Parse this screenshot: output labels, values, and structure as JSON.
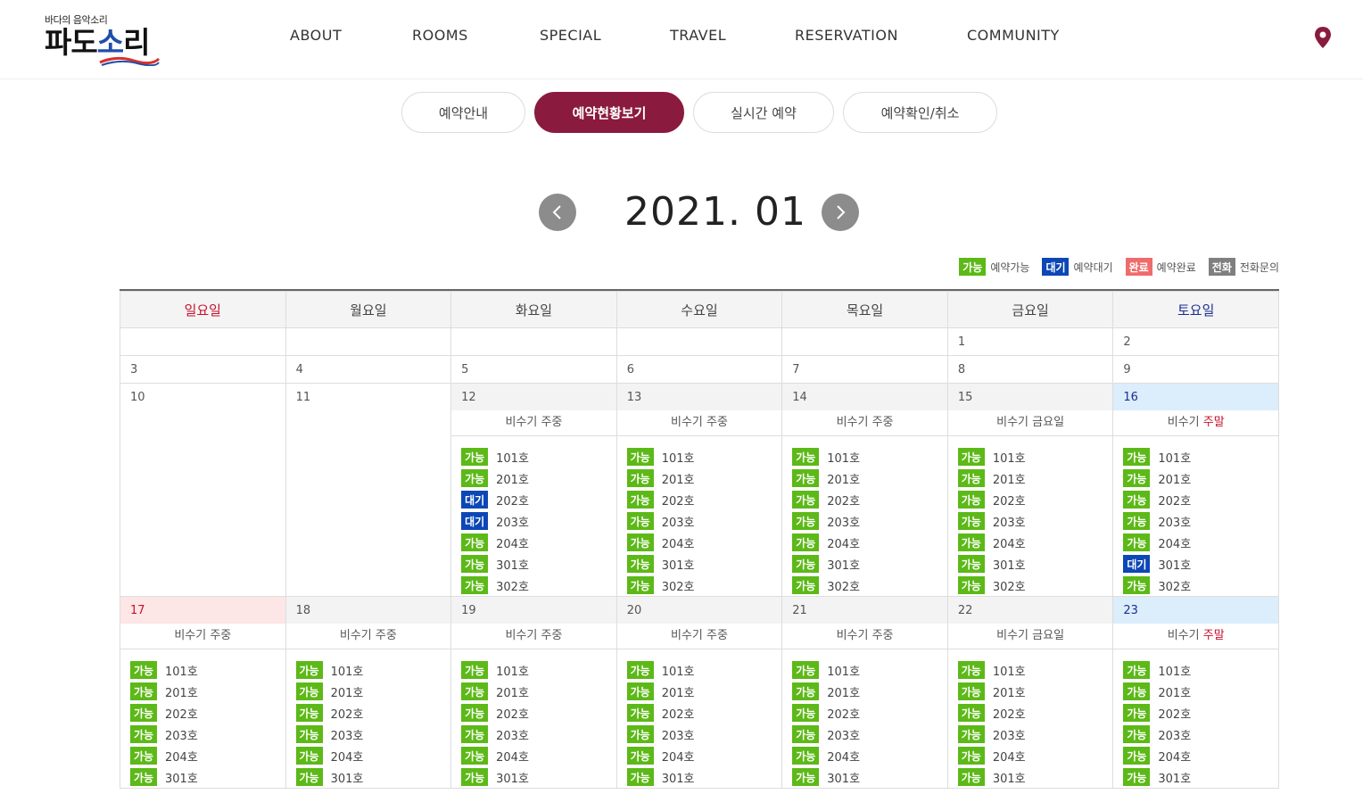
{
  "header": {
    "logo_tagline": "바다의 음악소리",
    "logo_text_1": "파도",
    "logo_text_2": "소",
    "logo_text_3": "리",
    "nav": [
      "ABOUT",
      "ROOMS",
      "SPECIAL",
      "TRAVEL",
      "RESERVATION",
      "COMMUNITY"
    ]
  },
  "tabs": [
    "예약안내",
    "예약현황보기",
    "실시간 예약",
    "예약확인/취소"
  ],
  "active_tab": 1,
  "month_title": "2021. 01",
  "legend": [
    {
      "badge": "가능",
      "label": "예약가능",
      "color": "#5cb917"
    },
    {
      "badge": "대기",
      "label": "예약대기",
      "color": "#0d47b6"
    },
    {
      "badge": "완료",
      "label": "예약완료",
      "color": "#f06b6b"
    },
    {
      "badge": "전화",
      "label": "전화문의",
      "color": "#7f7f7f"
    }
  ],
  "weekdays": [
    "일요일",
    "월요일",
    "화요일",
    "수요일",
    "목요일",
    "금요일",
    "토요일"
  ],
  "status_labels": {
    "g": "가능",
    "w": "대기",
    "d": "완료",
    "p": "전화"
  },
  "weeks": [
    {
      "days": [
        {
          "num": ""
        },
        {
          "num": ""
        },
        {
          "num": ""
        },
        {
          "num": ""
        },
        {
          "num": ""
        },
        {
          "num": "1"
        },
        {
          "num": "2"
        }
      ]
    },
    {
      "days": [
        {
          "num": "3"
        },
        {
          "num": "4"
        },
        {
          "num": "5"
        },
        {
          "num": "6"
        },
        {
          "num": "7"
        },
        {
          "num": "8"
        },
        {
          "num": "9"
        }
      ]
    },
    {
      "days": [
        {
          "num": "10"
        },
        {
          "num": "11"
        },
        {
          "num": "12",
          "season": "비수기 주중",
          "rooms": [
            [
              "g",
              "101호"
            ],
            [
              "g",
              "201호"
            ],
            [
              "w",
              "202호"
            ],
            [
              "w",
              "203호"
            ],
            [
              "g",
              "204호"
            ],
            [
              "g",
              "301호"
            ],
            [
              "g",
              "302호"
            ]
          ]
        },
        {
          "num": "13",
          "season": "비수기 주중",
          "rooms": [
            [
              "g",
              "101호"
            ],
            [
              "g",
              "201호"
            ],
            [
              "g",
              "202호"
            ],
            [
              "g",
              "203호"
            ],
            [
              "g",
              "204호"
            ],
            [
              "g",
              "301호"
            ],
            [
              "g",
              "302호"
            ]
          ]
        },
        {
          "num": "14",
          "season": "비수기 주중",
          "rooms": [
            [
              "g",
              "101호"
            ],
            [
              "g",
              "201호"
            ],
            [
              "g",
              "202호"
            ],
            [
              "g",
              "203호"
            ],
            [
              "g",
              "204호"
            ],
            [
              "g",
              "301호"
            ],
            [
              "g",
              "302호"
            ]
          ]
        },
        {
          "num": "15",
          "season": "비수기 금요일",
          "rooms": [
            [
              "g",
              "101호"
            ],
            [
              "g",
              "201호"
            ],
            [
              "g",
              "202호"
            ],
            [
              "g",
              "203호"
            ],
            [
              "g",
              "204호"
            ],
            [
              "g",
              "301호"
            ],
            [
              "g",
              "302호"
            ]
          ]
        },
        {
          "num": "16",
          "season": "비수기 ",
          "season_wk": "주말",
          "rooms": [
            [
              "g",
              "101호"
            ],
            [
              "g",
              "201호"
            ],
            [
              "g",
              "202호"
            ],
            [
              "g",
              "203호"
            ],
            [
              "g",
              "204호"
            ],
            [
              "w",
              "301호"
            ],
            [
              "g",
              "302호"
            ]
          ]
        }
      ]
    },
    {
      "days": [
        {
          "num": "17",
          "season": "비수기 주중",
          "rooms": [
            [
              "g",
              "101호"
            ],
            [
              "g",
              "201호"
            ],
            [
              "g",
              "202호"
            ],
            [
              "g",
              "203호"
            ],
            [
              "g",
              "204호"
            ],
            [
              "g",
              "301호"
            ]
          ]
        },
        {
          "num": "18",
          "season": "비수기 주중",
          "rooms": [
            [
              "g",
              "101호"
            ],
            [
              "g",
              "201호"
            ],
            [
              "g",
              "202호"
            ],
            [
              "g",
              "203호"
            ],
            [
              "g",
              "204호"
            ],
            [
              "g",
              "301호"
            ]
          ]
        },
        {
          "num": "19",
          "season": "비수기 주중",
          "rooms": [
            [
              "g",
              "101호"
            ],
            [
              "g",
              "201호"
            ],
            [
              "g",
              "202호"
            ],
            [
              "g",
              "203호"
            ],
            [
              "g",
              "204호"
            ],
            [
              "g",
              "301호"
            ]
          ]
        },
        {
          "num": "20",
          "season": "비수기 주중",
          "rooms": [
            [
              "g",
              "101호"
            ],
            [
              "g",
              "201호"
            ],
            [
              "g",
              "202호"
            ],
            [
              "g",
              "203호"
            ],
            [
              "g",
              "204호"
            ],
            [
              "g",
              "301호"
            ]
          ]
        },
        {
          "num": "21",
          "season": "비수기 주중",
          "rooms": [
            [
              "g",
              "101호"
            ],
            [
              "g",
              "201호"
            ],
            [
              "g",
              "202호"
            ],
            [
              "g",
              "203호"
            ],
            [
              "g",
              "204호"
            ],
            [
              "g",
              "301호"
            ]
          ]
        },
        {
          "num": "22",
          "season": "비수기 금요일",
          "rooms": [
            [
              "g",
              "101호"
            ],
            [
              "g",
              "201호"
            ],
            [
              "g",
              "202호"
            ],
            [
              "g",
              "203호"
            ],
            [
              "g",
              "204호"
            ],
            [
              "g",
              "301호"
            ]
          ]
        },
        {
          "num": "23",
          "season": "비수기 ",
          "season_wk": "주말",
          "rooms": [
            [
              "g",
              "101호"
            ],
            [
              "g",
              "201호"
            ],
            [
              "g",
              "202호"
            ],
            [
              "g",
              "203호"
            ],
            [
              "g",
              "204호"
            ],
            [
              "g",
              "301호"
            ]
          ]
        }
      ]
    }
  ]
}
